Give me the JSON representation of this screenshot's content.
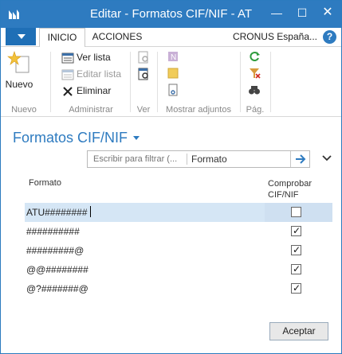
{
  "window": {
    "title": "Editar - Formatos CIF/NIF - AT",
    "minimize": "—",
    "maximize": "☐",
    "close": "✕"
  },
  "tabs": [
    {
      "label": "INICIO",
      "active": true
    },
    {
      "label": "ACCIONES",
      "active": false
    }
  ],
  "company": "CRONUS España...",
  "help": "?",
  "ribbon": {
    "groups": [
      {
        "label": "Nuevo",
        "items": [
          {
            "label": "Nuevo",
            "icon": "new-star-icon"
          }
        ]
      },
      {
        "label": "Administrar",
        "items": [
          {
            "label": "Ver lista",
            "icon": "view-list-icon",
            "enabled": true
          },
          {
            "label": "Editar lista",
            "icon": "edit-list-icon",
            "enabled": false
          },
          {
            "label": "Eliminar",
            "icon": "delete-x-icon",
            "enabled": true
          }
        ]
      },
      {
        "label": "Ver",
        "items": [
          {
            "icon": "view-page-icon"
          },
          {
            "icon": "find-page-icon"
          }
        ]
      },
      {
        "label": "Mostrar adjuntos",
        "items": [
          {
            "icon": "onenote-icon"
          },
          {
            "icon": "notes-icon"
          },
          {
            "icon": "links-icon"
          }
        ]
      },
      {
        "label": "Pág.",
        "items": [
          {
            "icon": "refresh-icon"
          },
          {
            "icon": "clear-filter-icon"
          },
          {
            "icon": "find-icon"
          }
        ]
      }
    ]
  },
  "page": {
    "title": "Formatos CIF/NIF"
  },
  "filter": {
    "placeholder": "Escribir para filtrar (...",
    "field": "Formato"
  },
  "table": {
    "columns": [
      "Formato",
      "Comprobar CIF/NIF"
    ],
    "rows": [
      {
        "format": "ATU########",
        "check": false,
        "selected": true
      },
      {
        "format": "##########",
        "check": true,
        "selected": false
      },
      {
        "format": "#########@",
        "check": true,
        "selected": false
      },
      {
        "format": "@@########",
        "check": true,
        "selected": false
      },
      {
        "format": "@?#######@",
        "check": true,
        "selected": false
      }
    ]
  },
  "footer": {
    "accept": "Aceptar"
  },
  "colors": {
    "accent": "#2e7bc0",
    "selected_row": "#d5e6f5"
  }
}
